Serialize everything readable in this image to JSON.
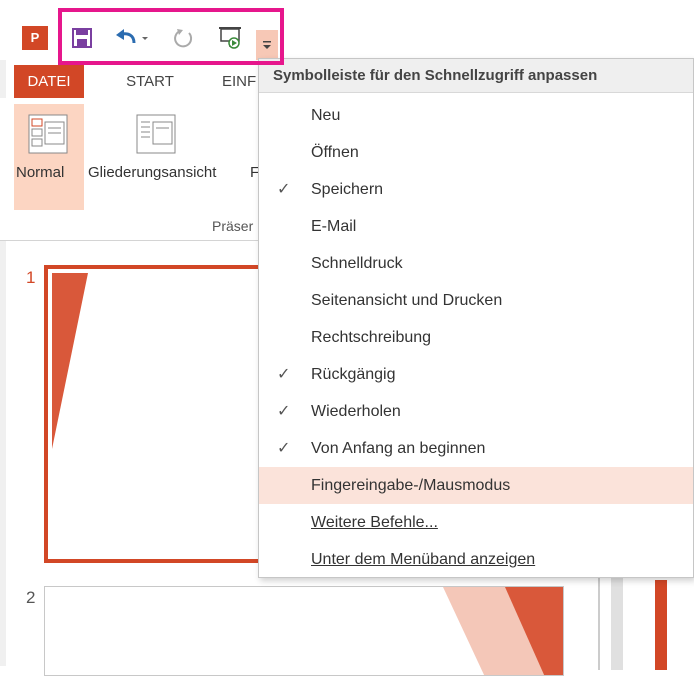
{
  "app": {
    "logo_text": "P"
  },
  "qat": {
    "save": "save-icon",
    "undo": "undo-icon",
    "redo": "redo-icon",
    "start": "slideshow-from-start-icon",
    "customize": "customize-arrow-icon",
    "highlight_color": "#e6168c"
  },
  "tabs": {
    "datei": "DATEI",
    "start": "START",
    "einf": "EINF"
  },
  "ribbon": {
    "normal": "Normal",
    "gliederung": "Gliederungsansicht",
    "partial": "F",
    "group": "Präser"
  },
  "slides": {
    "one": "1",
    "two": "2"
  },
  "menu": {
    "title": "Symbolleiste für den Schnellzugriff anpassen",
    "items": [
      {
        "label": "Neu",
        "checked": false
      },
      {
        "label": "Öffnen",
        "checked": false
      },
      {
        "label": "Speichern",
        "checked": true
      },
      {
        "label": "E-Mail",
        "checked": false
      },
      {
        "label": "Schnelldruck",
        "checked": false
      },
      {
        "label": "Seitenansicht und Drucken",
        "checked": false
      },
      {
        "label": "Rechtschreibung",
        "checked": false
      },
      {
        "label": "Rückgängig",
        "checked": true
      },
      {
        "label": "Wiederholen",
        "checked": true
      },
      {
        "label": "Von Anfang an beginnen",
        "checked": true
      },
      {
        "label": "Fingereingabe-/Mausmodus",
        "checked": false
      },
      {
        "label": "Weitere Befehle...",
        "checked": false
      },
      {
        "label": "Unter dem Menüband anzeigen",
        "checked": false
      }
    ],
    "checkmark": "✓"
  },
  "colors": {
    "accent": "#d24726",
    "hover": "#fbe3da"
  }
}
